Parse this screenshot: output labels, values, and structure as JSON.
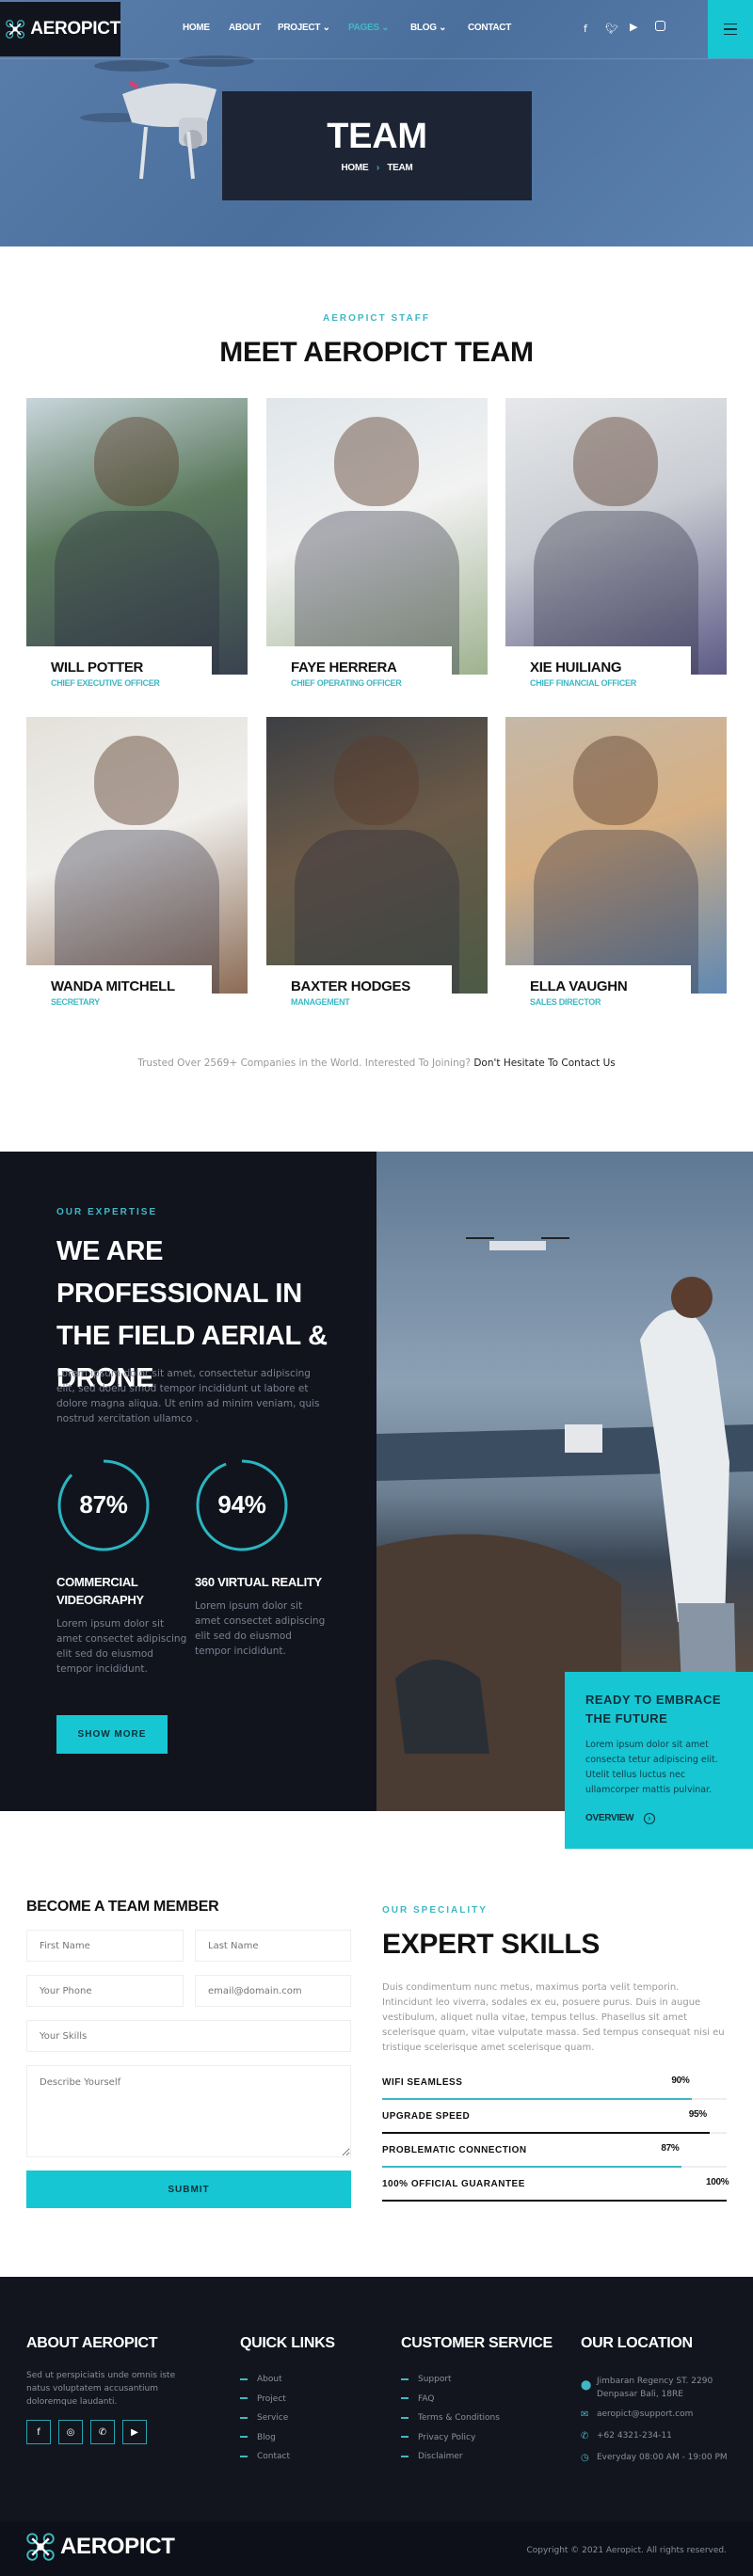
{
  "colors": {
    "accent": "#16c6d3",
    "dark": "#11141d",
    "heading": "#111111"
  },
  "brand": "AEROPICT",
  "nav": {
    "items": [
      "HOME",
      "ABOUT",
      "PROJECT",
      "PAGES",
      "BLOG",
      "CONTACT"
    ],
    "active": "PAGES",
    "social": [
      "facebook-icon",
      "twitter-icon",
      "youtube-icon",
      "instagram-icon"
    ]
  },
  "hero": {
    "title": "TEAM",
    "breadcrumb": [
      "HOME",
      "TEAM"
    ]
  },
  "team": {
    "eyebrow": "AEROPICT STAFF",
    "title": "MEET AEROPICT TEAM",
    "members": [
      {
        "name": "WILL POTTER",
        "role": "CHIEF EXECUTIVE OFFICER"
      },
      {
        "name": "FAYE HERRERA",
        "role": "CHIEF OPERATING OFFICER"
      },
      {
        "name": "XIE HUILIANG",
        "role": "CHIEF FINANCIAL OFFICER"
      },
      {
        "name": "WANDA MITCHELL",
        "role": "SECRETARY"
      },
      {
        "name": "BAXTER HODGES",
        "role": "MANAGEMENT"
      },
      {
        "name": "ELLA VAUGHN",
        "role": "SALES DIRECTOR"
      }
    ],
    "trusted": "Trusted Over 2569+ Companies in the World. Interested To Joining?",
    "contact_link": "Don't Hesitate To Contact Us"
  },
  "expertise": {
    "eyebrow": "OUR EXPERTISE",
    "title": "WE ARE PROFESSIONAL IN THE FIELD AERIAL & DRONE",
    "text": "Lorem ipsum dolor sit amet, consectetur adipiscing elit, sed doeiu smod tempor incididunt ut labore et dolore magna aliqua. Ut enim ad minim veniam, quis nostrud xercitation ullamco .",
    "stats": [
      {
        "percent": 87,
        "label": "87%",
        "title": "COMMERCIAL VIDEOGRAPHY",
        "text": "Lorem ipsum dolor sit amet consectet adipiscing elit sed do eiusmod tempor incididunt."
      },
      {
        "percent": 94,
        "label": "94%",
        "title": "360 VIRTUAL REALITY",
        "text": "Lorem ipsum dolor sit amet consectet adipiscing elit sed do eiusmod tempor incididunt."
      }
    ],
    "button": "SHOW MORE",
    "cta": {
      "title": "READY TO EMBRACE THE FUTURE",
      "text": "Lorem ipsum dolor sit amet consecta tetur adipiscing elit. Utelit tellus luctus nec ullamcorper mattis pulvinar.",
      "link": "OVERVIEW"
    }
  },
  "form": {
    "title": "BECOME A TEAM MEMBER",
    "first_name": "First Name",
    "last_name": "Last Name",
    "phone": "Your Phone",
    "email": "email@domain.com",
    "skills": "Your Skills",
    "describe": "Describe Yourself",
    "submit": "SUBMIT"
  },
  "skills": {
    "eyebrow": "OUR SPECIALITY",
    "title": "EXPERT SKILLS",
    "text": "Duis condimentum nunc metus, maximus porta velit temporin. Intincidunt leo viverra, sodales ex eu, posuere purus. Duis in augue vestibulum, aliquet nulla vitae, tempus tellus. Phasellus sit amet scelerisque quam, vitae vulputate massa. Sed tempus consequat nisi eu tristique scelerisque amet scelerisque quam.",
    "items": [
      {
        "label": "WIFI SEAMLESS",
        "value": 90,
        "text": "90%",
        "color": "#3fb8c3"
      },
      {
        "label": "UPGRADE SPEED",
        "value": 95,
        "text": "95%",
        "color": "#111111"
      },
      {
        "label": "PROBLEMATIC CONNECTION",
        "value": 87,
        "text": "87%",
        "color": "#3fb8c3"
      },
      {
        "label": "100% OFFICIAL GUARANTEE",
        "value": 100,
        "text": "100%",
        "color": "#111111"
      }
    ]
  },
  "footer": {
    "about": {
      "title": "ABOUT AEROPICT",
      "text": "Sed ut perspiciatis unde omnis iste natus voluptatem accusantium doloremque laudanti.",
      "social": [
        "facebook-icon",
        "instagram-icon",
        "whatsapp-icon",
        "youtube-icon"
      ]
    },
    "quick": {
      "title": "QUICK LINKS",
      "links": [
        "About",
        "Project",
        "Service",
        "Blog",
        "Contact"
      ]
    },
    "service": {
      "title": "CUSTOMER SERVICE",
      "links": [
        "Support",
        "FAQ",
        "Terms & Conditions",
        "Privacy Policy",
        "Disclaimer"
      ]
    },
    "location": {
      "title": "OUR LOCATION",
      "address": "Jimbaran Regency ST. 2290 Denpasar Bali, 18RE",
      "email": "aeropict@support.com",
      "phone": "+62 4321-234-11",
      "hours": "Everyday 08:00 AM - 19:00 PM"
    },
    "copyright": "Copyright © 2021 Aeropict. All rights reserved."
  }
}
